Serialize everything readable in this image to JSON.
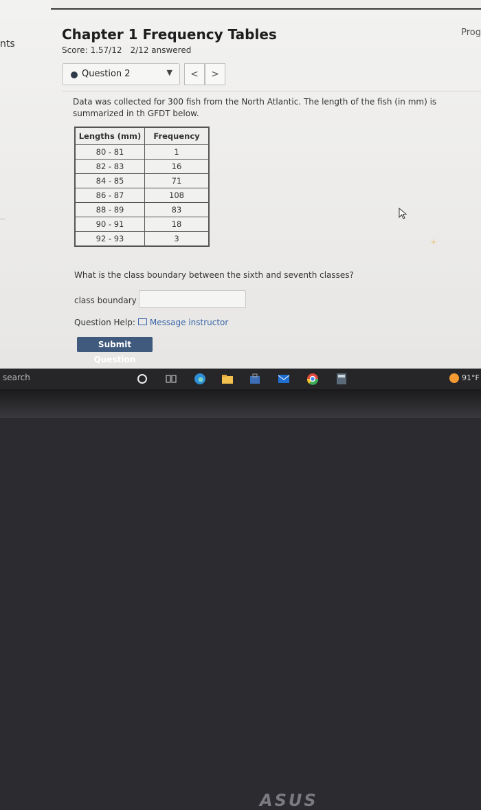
{
  "sidebar": {
    "fragment": "nts"
  },
  "header": {
    "title": "Chapter 1 Frequency Tables",
    "score": "Score: 1.57/12",
    "answered": "2/12 answered",
    "progress_fragment": "Prog"
  },
  "question_nav": {
    "selected": "Question 2",
    "prev": "<",
    "next": ">"
  },
  "problem": {
    "description": "Data was collected for 300 fish from the North Atlantic. The length of the fish (in mm) is summarized in th GFDT below.",
    "table": {
      "headers": [
        "Lengths (mm)",
        "Frequency"
      ],
      "rows": [
        [
          "80 - 81",
          "1"
        ],
        [
          "82 - 83",
          "16"
        ],
        [
          "84 - 85",
          "71"
        ],
        [
          "86 - 87",
          "108"
        ],
        [
          "88 - 89",
          "83"
        ],
        [
          "90 - 91",
          "18"
        ],
        [
          "92 - 93",
          "3"
        ]
      ]
    },
    "question": "What is the class boundary between the sixth and seventh classes?",
    "input_label": "class boundary =",
    "input_value": "",
    "help_label": "Question Help:",
    "help_link": "Message instructor",
    "submit": "Submit Question"
  },
  "taskbar": {
    "search": "search",
    "temperature": "91°F",
    "icons": [
      "cortana-icon",
      "task-view-icon",
      "edge-icon",
      "file-explorer-icon",
      "store-icon",
      "mail-icon",
      "chrome-icon",
      "calculator-icon"
    ]
  },
  "bezel": {
    "brand": "ASUS"
  },
  "colors": {
    "submit_bg": "#3f5a7c",
    "link": "#3a66a8",
    "weather": "#f39a32"
  }
}
